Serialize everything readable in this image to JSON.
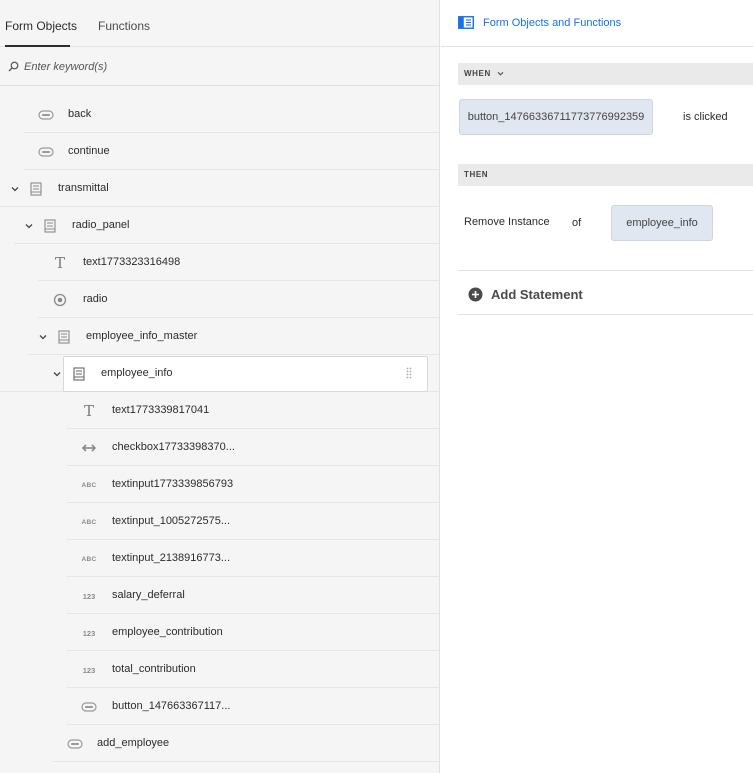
{
  "tabs": [
    {
      "label": "Form Objects"
    },
    {
      "label": "Functions"
    }
  ],
  "search": {
    "placeholder": "Enter keyword(s)"
  },
  "tree": [
    {
      "label": "back",
      "icon": "button-icon"
    },
    {
      "label": "continue",
      "icon": "button-icon"
    },
    {
      "label": "transmittal",
      "icon": "panel-icon"
    },
    {
      "label": "radio_panel",
      "icon": "panel-icon"
    },
    {
      "label": "text1773323316498",
      "icon": "text-icon"
    },
    {
      "label": "radio",
      "icon": "radio-icon"
    },
    {
      "label": "employee_info_master",
      "icon": "panel-icon"
    },
    {
      "label": "employee_info",
      "icon": "panel-icon"
    },
    {
      "label": "text1773339817041",
      "icon": "text-icon"
    },
    {
      "label": "checkbox17733398370...",
      "icon": "checkbox-icon"
    },
    {
      "label": "textinput1773339856793",
      "icon": "textinput-icon"
    },
    {
      "label": "textinput_1005272575...",
      "icon": "textinput-icon"
    },
    {
      "label": "textinput_2138916773...",
      "icon": "textinput-icon"
    },
    {
      "label": "salary_deferral",
      "icon": "numeric-icon"
    },
    {
      "label": "employee_contribution",
      "icon": "numeric-icon"
    },
    {
      "label": "total_contribution",
      "icon": "numeric-icon"
    },
    {
      "label": "button_147663367117...",
      "icon": "button-icon"
    },
    {
      "label": "add_employee",
      "icon": "button-icon"
    }
  ],
  "icon_text": {
    "abc": "ABC",
    "num": "123",
    "t": "T"
  },
  "right_panel": {
    "title": "Form Objects and Functions",
    "when": {
      "header": "WHEN",
      "object": "button_1476633671177377699235​9",
      "condition": "is clicked"
    },
    "then": {
      "header": "THEN",
      "action": "Remove Instance",
      "of": "of",
      "target": "employee_info"
    },
    "add_statement": "Add Statement"
  },
  "colors": {
    "accent": "#1473e6",
    "pill": "#e0e7f0",
    "panel": "#f5f5f5"
  }
}
